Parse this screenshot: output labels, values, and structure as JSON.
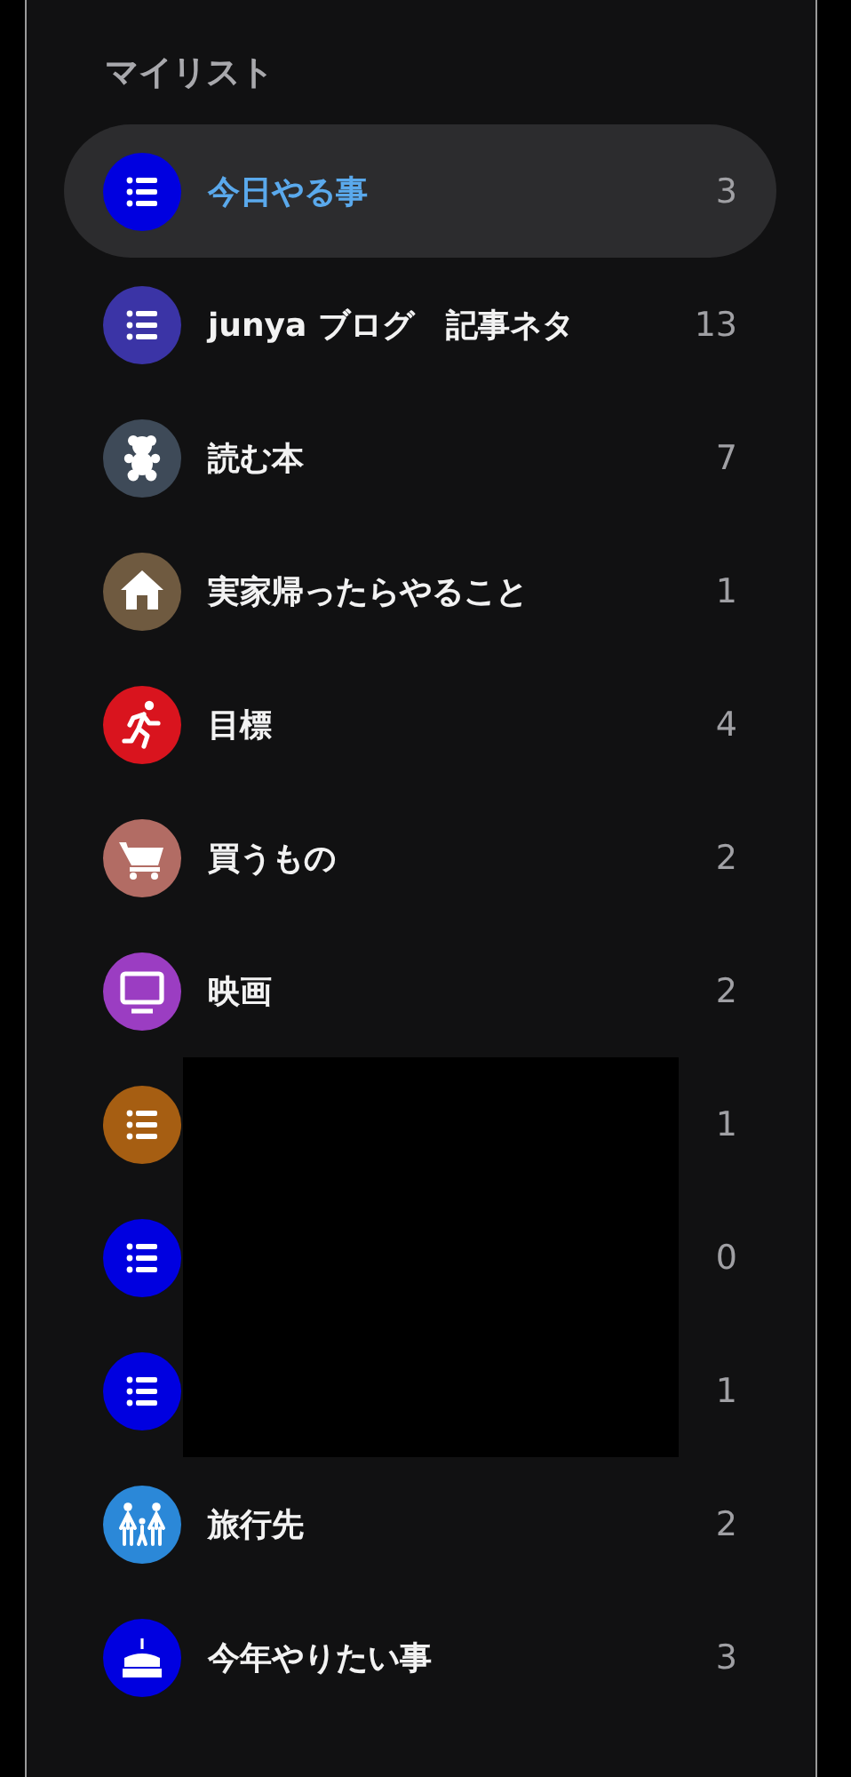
{
  "section_title": "マイリスト",
  "lists": [
    {
      "name": "今日やる事",
      "count": "3",
      "kind": "list",
      "color": "#0000e0",
      "selected": true,
      "redacted": false
    },
    {
      "name": "junya ブログ　記事ネタ",
      "count": "13",
      "kind": "list",
      "color": "#3b34a6",
      "selected": false,
      "redacted": false
    },
    {
      "name": "読む本",
      "count": "7",
      "kind": "bear",
      "color": "#3e4a58",
      "selected": false,
      "redacted": false
    },
    {
      "name": "実家帰ったらやること",
      "count": "1",
      "kind": "house",
      "color": "#6f5a40",
      "selected": false,
      "redacted": false
    },
    {
      "name": "目標",
      "count": "4",
      "kind": "runner",
      "color": "#d9141e",
      "selected": false,
      "redacted": false
    },
    {
      "name": "買うもの",
      "count": "2",
      "kind": "cart",
      "color": "#b26c64",
      "selected": false,
      "redacted": false
    },
    {
      "name": "映画",
      "count": "2",
      "kind": "tv",
      "color": "#9b3dc2",
      "selected": false,
      "redacted": false
    },
    {
      "count": "1",
      "kind": "list",
      "color": "#a65e12",
      "selected": false,
      "redacted": true
    },
    {
      "count": "0",
      "kind": "list",
      "color": "#0000e0",
      "selected": false,
      "redacted": true
    },
    {
      "count": "1",
      "kind": "list",
      "color": "#0000e0",
      "selected": false,
      "redacted": true
    },
    {
      "name": "旅行先",
      "count": "2",
      "kind": "family",
      "color": "#2b88d8",
      "selected": false,
      "redacted": false
    },
    {
      "name": "今年やりたい事",
      "count": "3",
      "kind": "cake",
      "color": "#0000e0",
      "selected": false,
      "redacted": false
    }
  ]
}
